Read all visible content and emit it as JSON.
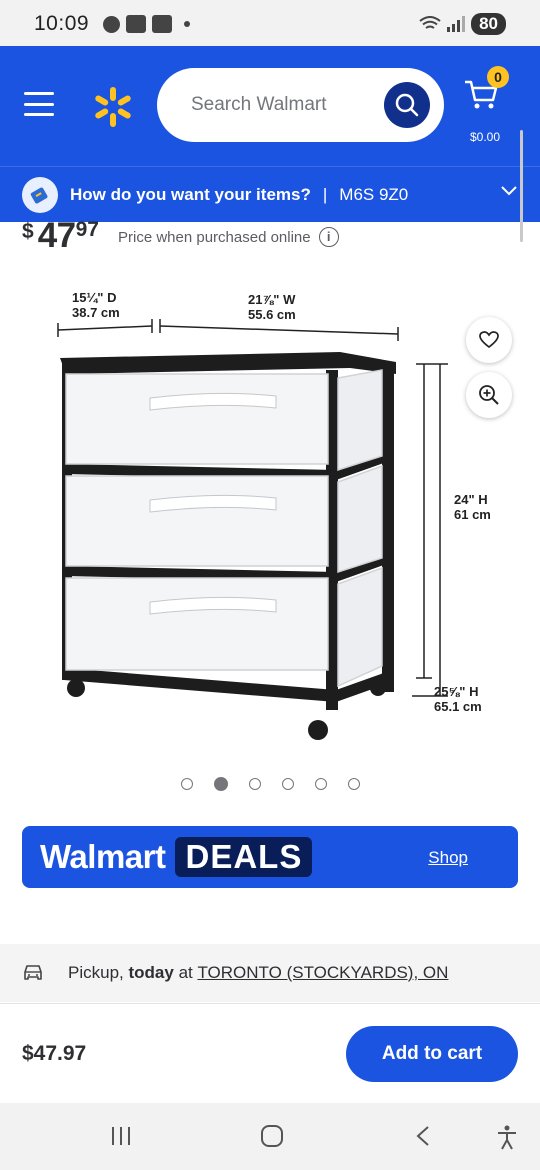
{
  "status": {
    "time": "10:09",
    "battery": "80"
  },
  "header": {
    "search_placeholder": "Search Walmart",
    "cart_count": "0",
    "cart_total": "$0.00"
  },
  "fulfilment": {
    "question": "How do you want your items?",
    "separator": "|",
    "postal_code": "M6S 9Z0"
  },
  "price": {
    "dollar_sign": "$",
    "whole": "47",
    "cents": "97",
    "note": "Price when purchased online",
    "info": "i"
  },
  "product": {
    "dims": {
      "depth": "15¼\" D",
      "depth_cm": "38.7 cm",
      "width": "21⅞\" W",
      "width_cm": "55.6 cm",
      "height": "24\" H",
      "height_cm": "61 cm",
      "total_height": "25⅝\" H",
      "total_height_cm": "65.1 cm"
    },
    "carousel_count": 6,
    "carousel_active": 2
  },
  "deals": {
    "brand": "Walmart",
    "tag": "DEALS",
    "shop": "Shop"
  },
  "pickup": {
    "label": "Pickup,",
    "when": "today",
    "at": "at",
    "location": "TORONTO (STOCKYARDS), ON"
  },
  "buybar": {
    "total": "$47.97",
    "add_label": "Add to cart"
  },
  "colors": {
    "brand_blue": "#1b54e0",
    "spark_yellow": "#ffc220",
    "dark_navy": "#091e59"
  }
}
